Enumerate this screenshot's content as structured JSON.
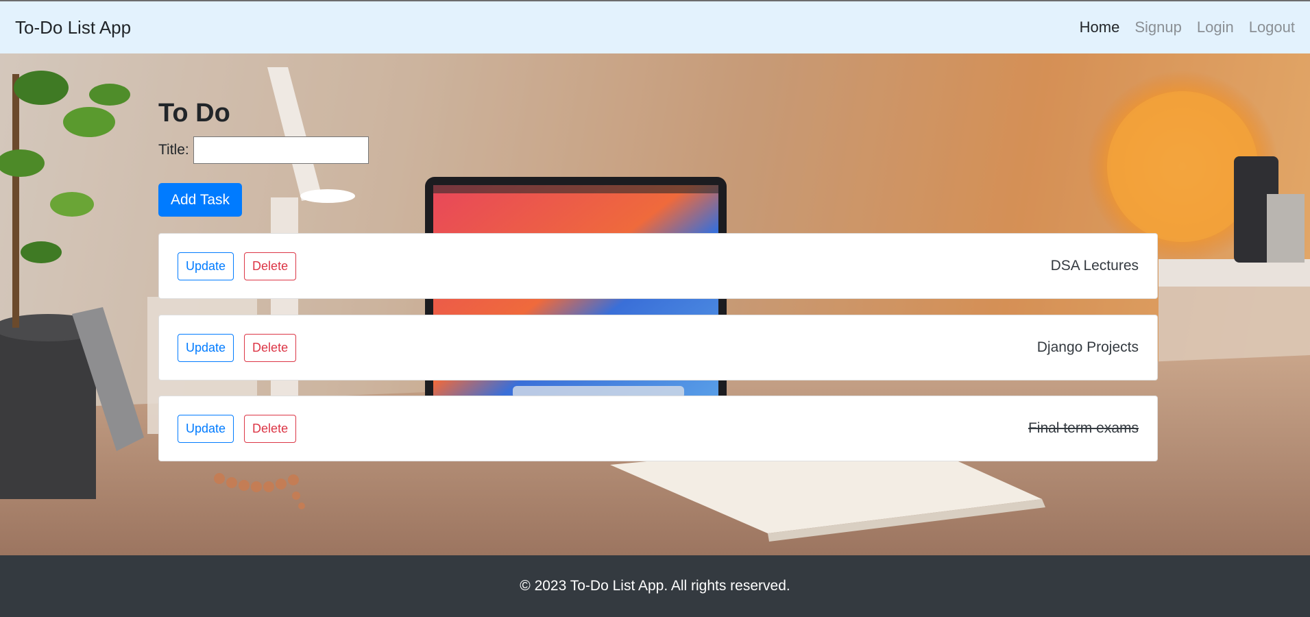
{
  "navbar": {
    "brand": "To-Do List App",
    "links": [
      {
        "label": "Home",
        "active": true
      },
      {
        "label": "Signup",
        "active": false
      },
      {
        "label": "Login",
        "active": false
      },
      {
        "label": "Logout",
        "active": false
      }
    ]
  },
  "main": {
    "title": "To Do",
    "form": {
      "title_label": "Title:",
      "title_value": "",
      "add_button": "Add Task"
    },
    "tasks": [
      {
        "title": "DSA Lectures",
        "completed": false,
        "update_label": "Update",
        "delete_label": "Delete"
      },
      {
        "title": "Django Projects",
        "completed": false,
        "update_label": "Update",
        "delete_label": "Delete"
      },
      {
        "title": "Final term exams",
        "completed": true,
        "update_label": "Update",
        "delete_label": "Delete"
      }
    ]
  },
  "footer": {
    "copyright": "© 2023 To-Do List App. All rights reserved."
  },
  "colors": {
    "navbar_bg": "#e3f2fd",
    "primary": "#007bff",
    "danger": "#dc3545",
    "footer_bg": "#343a40"
  }
}
